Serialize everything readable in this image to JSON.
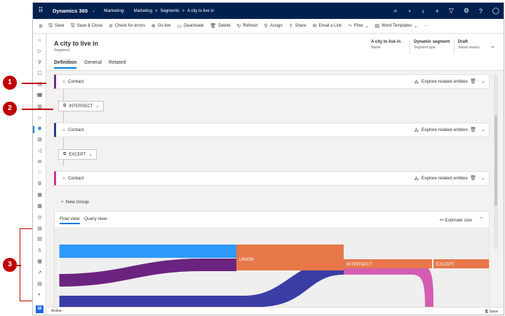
{
  "topbar": {
    "app_name": "Dynamics 365",
    "area": "Marketing",
    "breadcrumb": [
      "Marketing",
      ">",
      "Segments",
      ">",
      "A city to live in"
    ],
    "icons": [
      "search-icon",
      "task-icon",
      "lightbulb-icon",
      "plus-icon",
      "filter-icon",
      "gear-icon",
      "help-icon",
      "user-icon"
    ]
  },
  "commands": [
    {
      "icon": "save-icon",
      "glyph": "🖫",
      "label": "Save"
    },
    {
      "icon": "save-close-icon",
      "glyph": "🖫",
      "label": "Save & Close"
    },
    {
      "icon": "check-errors-icon",
      "glyph": "⊘",
      "label": "Check for errors"
    },
    {
      "icon": "go-live-icon",
      "glyph": "⊕",
      "label": "Go live"
    },
    {
      "icon": "deactivate-icon",
      "glyph": "▭",
      "label": "Deactivate"
    },
    {
      "icon": "delete-icon",
      "glyph": "🗑",
      "label": "Delete"
    },
    {
      "icon": "refresh-icon",
      "glyph": "↻",
      "label": "Refresh"
    },
    {
      "icon": "assign-icon",
      "glyph": "⚲",
      "label": "Assign"
    },
    {
      "icon": "share-icon",
      "glyph": "⇪",
      "label": "Share"
    },
    {
      "icon": "email-link-icon",
      "glyph": "✉",
      "label": "Email a Link"
    },
    {
      "icon": "flow-icon",
      "glyph": "⤳",
      "label": "Flow"
    },
    {
      "icon": "word-templates-icon",
      "glyph": "▤",
      "label": "Word Templates"
    }
  ],
  "more_glyph": "···",
  "record": {
    "title": "A city to live in",
    "type": "Segment",
    "fields": [
      {
        "value": "A city to live in",
        "label": "Name"
      },
      {
        "value": "Dynamic segment",
        "label": "Segment type"
      },
      {
        "value": "Draft",
        "label": "Status reason"
      }
    ]
  },
  "tabs": [
    "Definition",
    "General",
    "Related"
  ],
  "query_blocks": [
    {
      "entity": "Contact",
      "action": "Explore related entities"
    },
    {
      "entity": "Contact",
      "action": "Explore related entities"
    },
    {
      "entity": "Contact",
      "action": "Explore related entities"
    }
  ],
  "operators": [
    "INTERSECT",
    "EXCEPT"
  ],
  "new_group_label": "New Group",
  "flow": {
    "tabs": [
      "Flow view",
      "Query view"
    ],
    "estimate_label": "Estimate size",
    "nodes": [
      "UNION",
      "INTERSECT",
      "EXCEPT"
    ]
  },
  "status": {
    "text": "Active",
    "save": "Save"
  },
  "callouts": [
    "1",
    "2",
    "3"
  ],
  "sidenav_initial": "M",
  "colors": {
    "topbar": "#002050",
    "accent": "#0078d4",
    "callout": "#c00000",
    "flow_blue": "#2e9af9",
    "flow_purple": "#6b2380",
    "flow_navy": "#3b3da6",
    "flow_pink": "#d04cac",
    "flow_orange": "#e8774a"
  }
}
